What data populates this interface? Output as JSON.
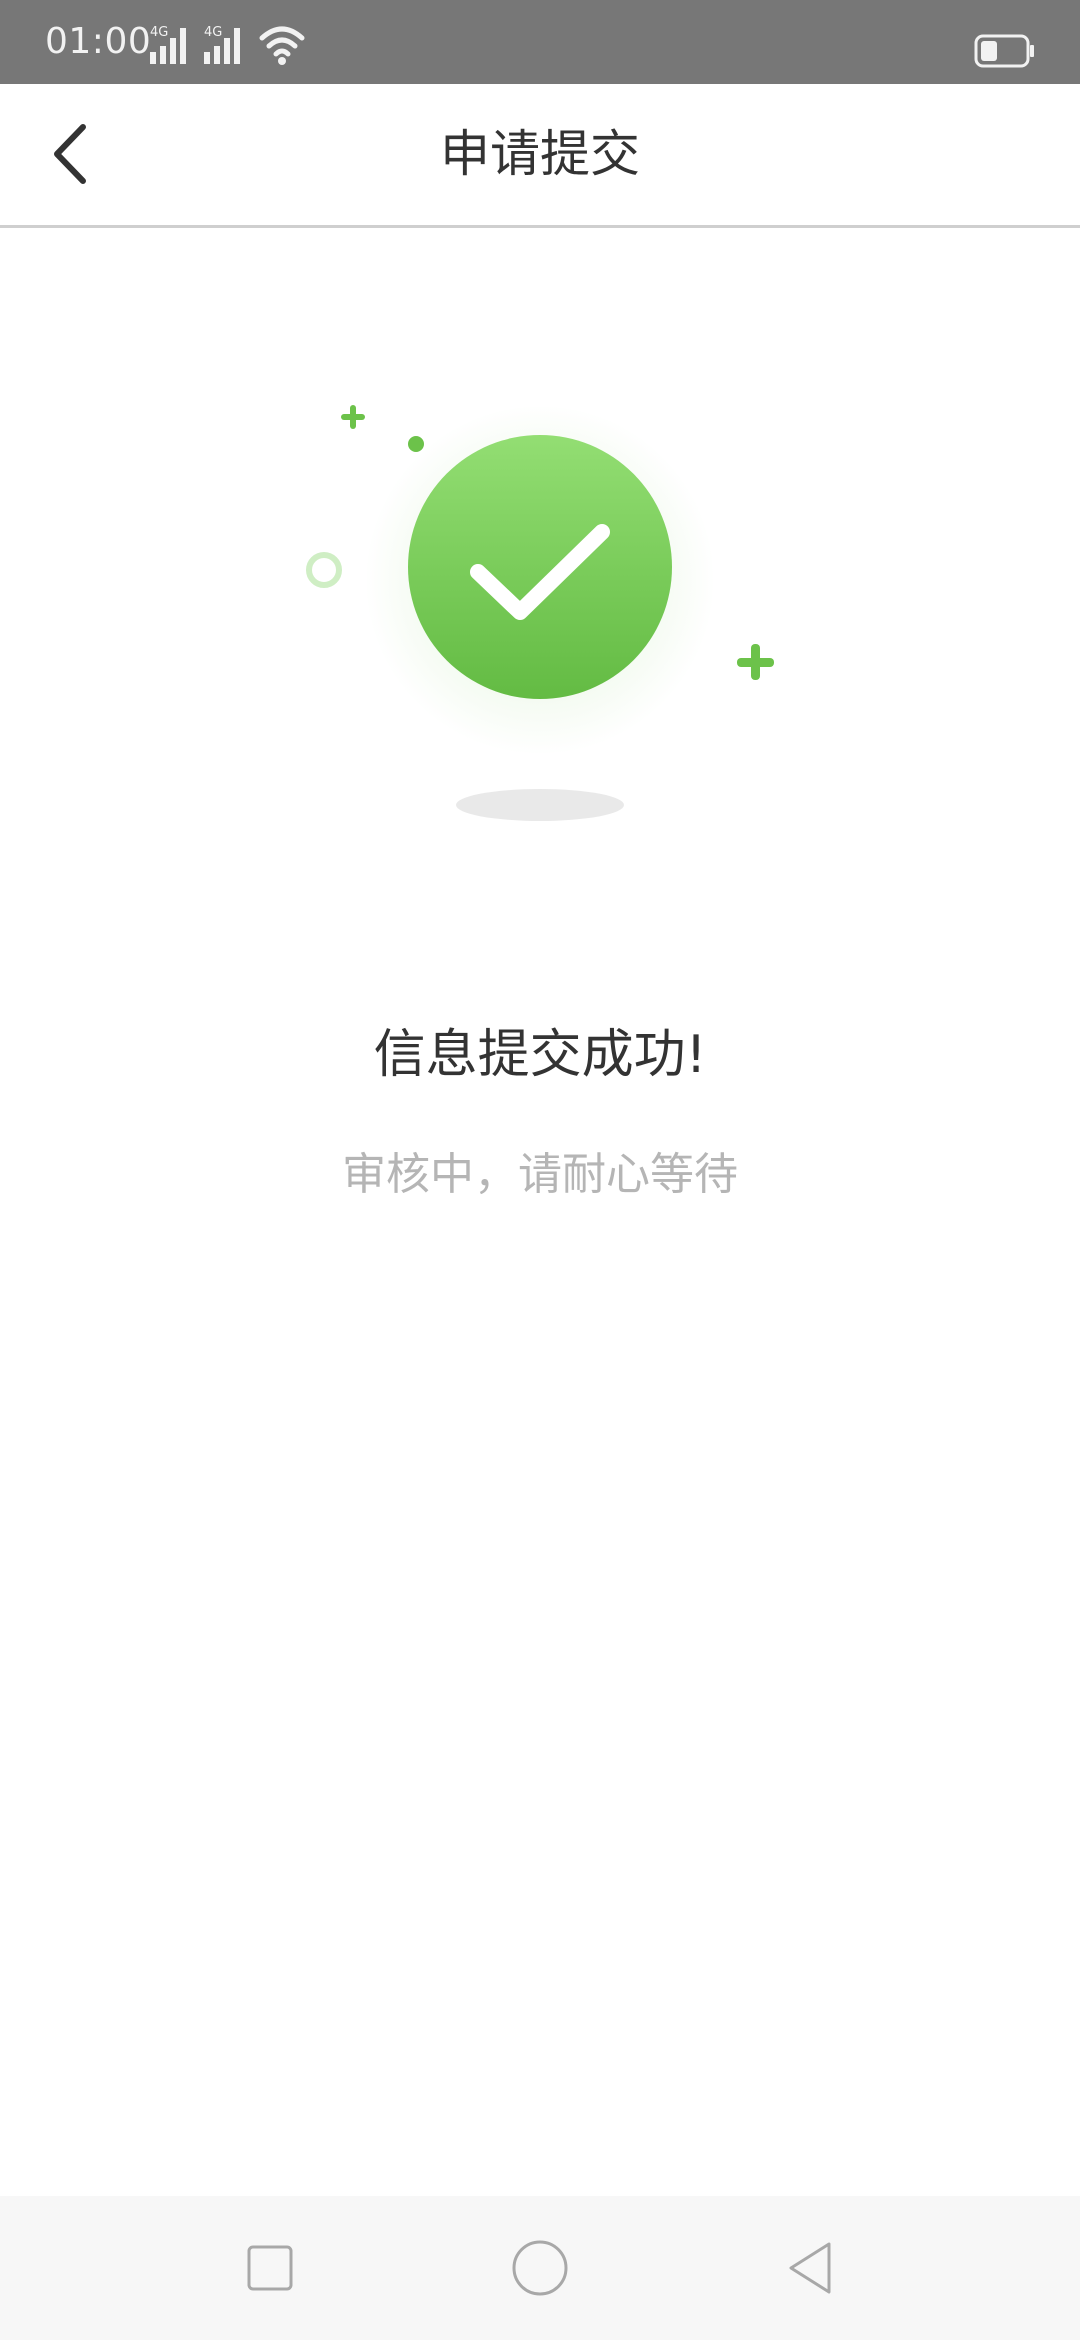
{
  "status_bar": {
    "time": "01:00",
    "network_1": "4G",
    "network_2": "4G",
    "icons": [
      "signal-icon",
      "signal-icon",
      "wifi-icon",
      "battery-icon"
    ]
  },
  "header": {
    "title": "申请提交",
    "back_icon": "chevron-left-icon"
  },
  "result": {
    "title": "信息提交成功!",
    "subtitle": "审核中，请耐心等待",
    "icon": "check-circle-icon"
  },
  "nav_bar": {
    "icons": [
      "square-icon",
      "circle-icon",
      "triangle-back-icon"
    ]
  },
  "colors": {
    "status_bar_bg": "#777777",
    "accent_green": "#6cc24a",
    "title_text": "#333333",
    "subtitle_text": "#b5b5b5",
    "nav_bg": "#f7f7f7"
  }
}
